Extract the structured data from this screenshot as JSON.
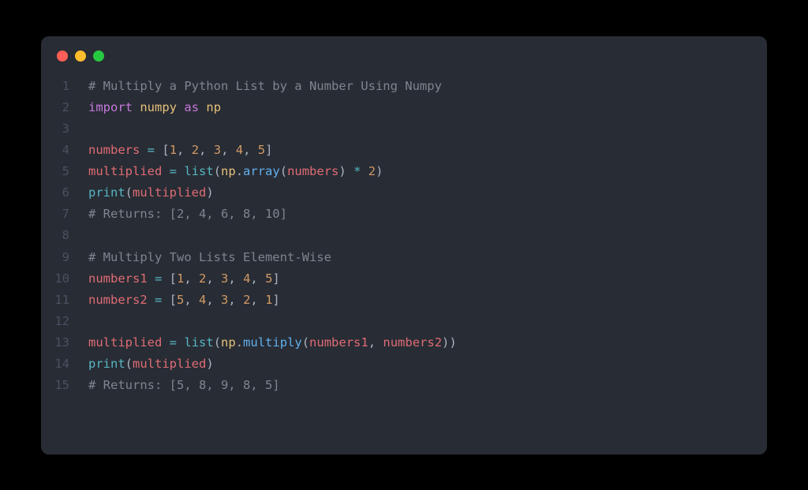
{
  "window": {
    "traffic_lights": {
      "red": "#ff5f56",
      "yellow": "#ffbd2e",
      "green": "#27c93f"
    }
  },
  "code": {
    "lines": [
      {
        "n": "1",
        "tokens": [
          {
            "t": "# Multiply a Python List by a Number Using Numpy",
            "c": "comment"
          }
        ]
      },
      {
        "n": "2",
        "tokens": [
          {
            "t": "import",
            "c": "keyword"
          },
          {
            "t": " ",
            "c": "punct"
          },
          {
            "t": "numpy",
            "c": "module"
          },
          {
            "t": " ",
            "c": "punct"
          },
          {
            "t": "as",
            "c": "keyword"
          },
          {
            "t": " ",
            "c": "punct"
          },
          {
            "t": "np",
            "c": "module"
          }
        ]
      },
      {
        "n": "3",
        "tokens": []
      },
      {
        "n": "4",
        "tokens": [
          {
            "t": "numbers",
            "c": "variable"
          },
          {
            "t": " ",
            "c": "punct"
          },
          {
            "t": "=",
            "c": "operator"
          },
          {
            "t": " [",
            "c": "punct"
          },
          {
            "t": "1",
            "c": "number"
          },
          {
            "t": ", ",
            "c": "punct"
          },
          {
            "t": "2",
            "c": "number"
          },
          {
            "t": ", ",
            "c": "punct"
          },
          {
            "t": "3",
            "c": "number"
          },
          {
            "t": ", ",
            "c": "punct"
          },
          {
            "t": "4",
            "c": "number"
          },
          {
            "t": ", ",
            "c": "punct"
          },
          {
            "t": "5",
            "c": "number"
          },
          {
            "t": "]",
            "c": "punct"
          }
        ]
      },
      {
        "n": "5",
        "tokens": [
          {
            "t": "multiplied",
            "c": "variable"
          },
          {
            "t": " ",
            "c": "punct"
          },
          {
            "t": "=",
            "c": "operator"
          },
          {
            "t": " ",
            "c": "punct"
          },
          {
            "t": "list",
            "c": "builtin"
          },
          {
            "t": "(",
            "c": "paren"
          },
          {
            "t": "np",
            "c": "module"
          },
          {
            "t": ".",
            "c": "punct"
          },
          {
            "t": "array",
            "c": "function"
          },
          {
            "t": "(",
            "c": "paren"
          },
          {
            "t": "numbers",
            "c": "variable"
          },
          {
            "t": ")",
            "c": "paren"
          },
          {
            "t": " ",
            "c": "punct"
          },
          {
            "t": "*",
            "c": "operator"
          },
          {
            "t": " ",
            "c": "punct"
          },
          {
            "t": "2",
            "c": "number"
          },
          {
            "t": ")",
            "c": "paren"
          }
        ]
      },
      {
        "n": "6",
        "tokens": [
          {
            "t": "print",
            "c": "builtin"
          },
          {
            "t": "(",
            "c": "paren"
          },
          {
            "t": "multiplied",
            "c": "variable"
          },
          {
            "t": ")",
            "c": "paren"
          }
        ]
      },
      {
        "n": "7",
        "tokens": [
          {
            "t": "# Returns: [2, 4, 6, 8, 10]",
            "c": "comment"
          }
        ]
      },
      {
        "n": "8",
        "tokens": []
      },
      {
        "n": "9",
        "tokens": [
          {
            "t": "# Multiply Two Lists Element-Wise",
            "c": "comment"
          }
        ]
      },
      {
        "n": "10",
        "tokens": [
          {
            "t": "numbers1",
            "c": "variable"
          },
          {
            "t": " ",
            "c": "punct"
          },
          {
            "t": "=",
            "c": "operator"
          },
          {
            "t": " [",
            "c": "punct"
          },
          {
            "t": "1",
            "c": "number"
          },
          {
            "t": ", ",
            "c": "punct"
          },
          {
            "t": "2",
            "c": "number"
          },
          {
            "t": ", ",
            "c": "punct"
          },
          {
            "t": "3",
            "c": "number"
          },
          {
            "t": ", ",
            "c": "punct"
          },
          {
            "t": "4",
            "c": "number"
          },
          {
            "t": ", ",
            "c": "punct"
          },
          {
            "t": "5",
            "c": "number"
          },
          {
            "t": "]",
            "c": "punct"
          }
        ]
      },
      {
        "n": "11",
        "tokens": [
          {
            "t": "numbers2",
            "c": "variable"
          },
          {
            "t": " ",
            "c": "punct"
          },
          {
            "t": "=",
            "c": "operator"
          },
          {
            "t": " [",
            "c": "punct"
          },
          {
            "t": "5",
            "c": "number"
          },
          {
            "t": ", ",
            "c": "punct"
          },
          {
            "t": "4",
            "c": "number"
          },
          {
            "t": ", ",
            "c": "punct"
          },
          {
            "t": "3",
            "c": "number"
          },
          {
            "t": ", ",
            "c": "punct"
          },
          {
            "t": "2",
            "c": "number"
          },
          {
            "t": ", ",
            "c": "punct"
          },
          {
            "t": "1",
            "c": "number"
          },
          {
            "t": "]",
            "c": "punct"
          }
        ]
      },
      {
        "n": "12",
        "tokens": []
      },
      {
        "n": "13",
        "tokens": [
          {
            "t": "multiplied",
            "c": "variable"
          },
          {
            "t": " ",
            "c": "punct"
          },
          {
            "t": "=",
            "c": "operator"
          },
          {
            "t": " ",
            "c": "punct"
          },
          {
            "t": "list",
            "c": "builtin"
          },
          {
            "t": "(",
            "c": "paren"
          },
          {
            "t": "np",
            "c": "module"
          },
          {
            "t": ".",
            "c": "punct"
          },
          {
            "t": "multiply",
            "c": "function"
          },
          {
            "t": "(",
            "c": "paren"
          },
          {
            "t": "numbers1",
            "c": "variable"
          },
          {
            "t": ", ",
            "c": "punct"
          },
          {
            "t": "numbers2",
            "c": "variable"
          },
          {
            "t": ")",
            "c": "paren"
          },
          {
            "t": ")",
            "c": "paren"
          }
        ]
      },
      {
        "n": "14",
        "tokens": [
          {
            "t": "print",
            "c": "builtin"
          },
          {
            "t": "(",
            "c": "paren"
          },
          {
            "t": "multiplied",
            "c": "variable"
          },
          {
            "t": ")",
            "c": "paren"
          }
        ]
      },
      {
        "n": "15",
        "tokens": [
          {
            "t": "# Returns: [5, 8, 9, 8, 5]",
            "c": "comment"
          }
        ]
      }
    ]
  }
}
